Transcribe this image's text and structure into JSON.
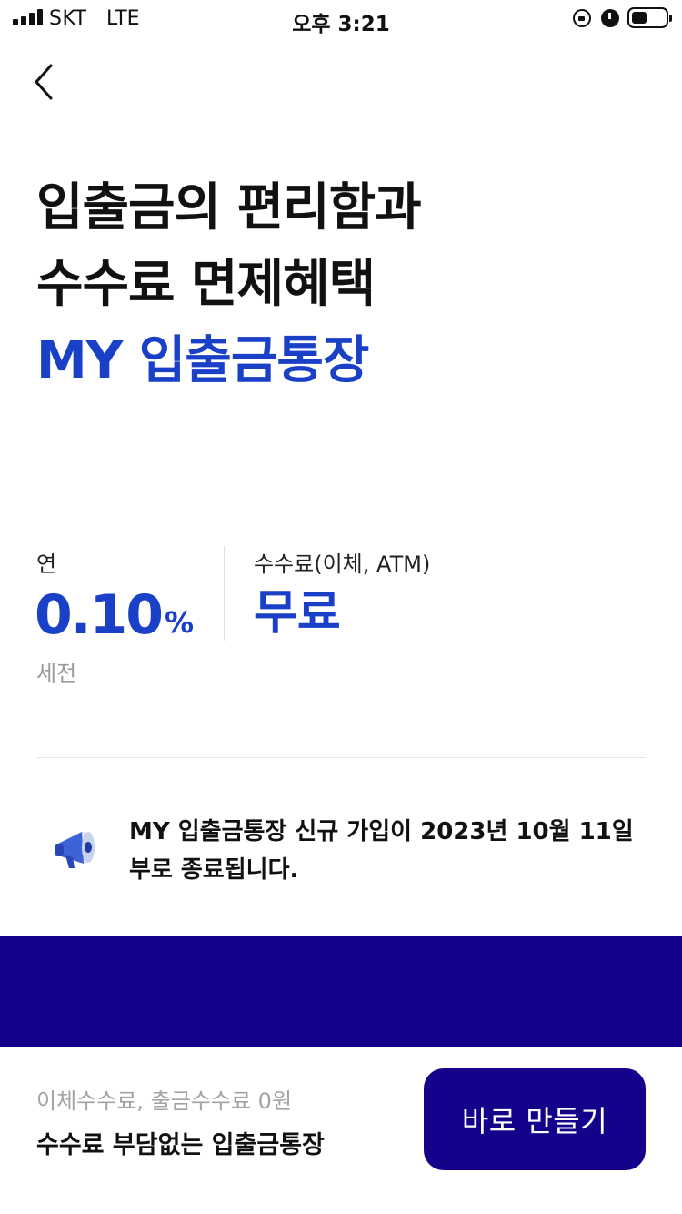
{
  "status_bar": {
    "carrier": "SKT",
    "network": "LTE",
    "time": "오후 3:21",
    "icons": [
      "signal-icon",
      "lock-rotation-icon",
      "alarm-icon",
      "battery-icon"
    ]
  },
  "nav": {
    "back_icon": "chevron-left-icon"
  },
  "hero": {
    "line1": "입출금의 편리함과",
    "line2": "수수료 면제혜택",
    "line3": "MY 입출금통장"
  },
  "rate": {
    "caption": "연",
    "value": "0.10",
    "unit": "%",
    "note": "세전"
  },
  "fee": {
    "caption": "수수료(이체, ATM)",
    "value": "무료"
  },
  "notice": {
    "icon": "megaphone-icon",
    "text": "MY 입출금통장 신규 가입이 2023년 10월 11일부로 종료됩니다."
  },
  "bottom": {
    "subtitle": "이체수수료, 출금수수료 0원",
    "title": "수수료 부담없는 입출금통장",
    "cta": "바로 만들기"
  },
  "colors": {
    "accent": "#1a40c7",
    "brand_navy": "#14038a",
    "muted": "#9a9a9a"
  }
}
